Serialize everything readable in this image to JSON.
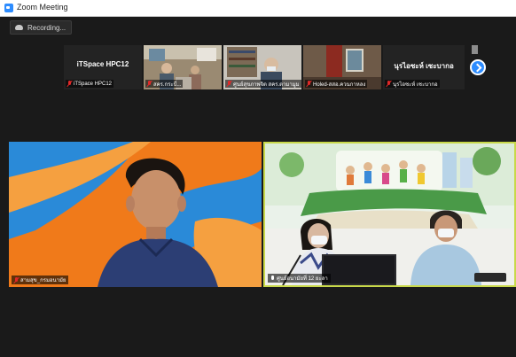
{
  "window": {
    "title": "Zoom Meeting"
  },
  "recording": {
    "label": "Recording..."
  },
  "thumbnails": [
    {
      "big_label": "iTSpace HPC12",
      "caption": "iTSpace HPC12",
      "muted": true
    },
    {
      "big_label": "",
      "caption": "สคร.กระบี่...",
      "muted": true
    },
    {
      "big_label": "",
      "caption": "ศูนย์สุขภาพจิต สคร.ตามามูม",
      "muted": true
    },
    {
      "big_label": "",
      "caption": "Holed-สสอ.ควนกาหลง",
      "muted": true
    },
    {
      "big_label": "นุรไอซะห์ เซะบากอ",
      "caption": "นุรไอซะห์ เซะบากอ",
      "muted": true
    }
  ],
  "main_tiles": [
    {
      "caption": "สามสุข_กรมอนามัย",
      "muted": true
    },
    {
      "caption": "ศูนย์อนามัยที่ 12 ยะลา",
      "muted": false
    }
  ],
  "colors": {
    "accent": "#2d8cff",
    "active_speaker_border": "#c8d84a",
    "background": "#1a1a1a",
    "muted_icon": "#e02828"
  }
}
